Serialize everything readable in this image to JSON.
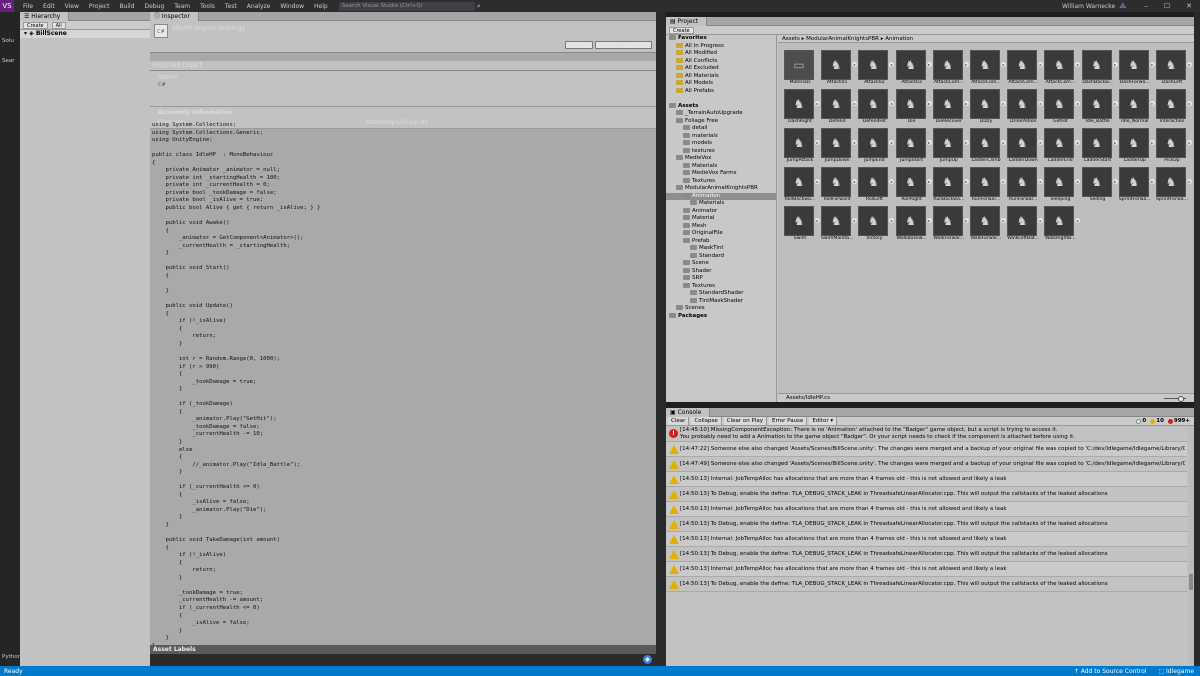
{
  "vs": {
    "logo": "VS",
    "menu": [
      "File",
      "Edit",
      "View",
      "Project",
      "Build",
      "Debug",
      "Team",
      "Tools",
      "Test",
      "Analyze",
      "Window",
      "Help"
    ],
    "search_placeholder": "Search Visual Studio (Ctrl+Q)",
    "user": "William Warnecke",
    "left_labels": [
      "Solu",
      "Sear",
      "Python"
    ]
  },
  "status": {
    "left": "Ready",
    "source_control": "Add to Source Control",
    "project": "Idlegame"
  },
  "hierarchy": {
    "tab": "Hierarchy",
    "create": "Create",
    "filter": "All",
    "scene": "BillScene"
  },
  "inspector": {
    "tab": "Inspector",
    "title": "IdleHP Import Settings",
    "btn_open": "Open...",
    "btn_exec": "Execution Order...",
    "imported_object": "Imported Object",
    "script_name": "IdleHP",
    "cs": "C#",
    "assembly_header": "Assembly Information",
    "filename_key": "Filename",
    "filename_value": "Assembly-CSharp.dll",
    "code": "using System.Collections;\nusing System.Collections.Generic;\nusing UnityEngine;\n\npublic class IdleHP  : MonoBehaviour\n{\n    private Animator _animator = null;\n    private int _startingHealth = 100;\n    private int _currentHealth = 0;\n    private bool _tookDamage = false;\n    private bool _isAlive = true;\n    public bool Alive { get { return _isAlive; } }\n\n    public void Awake()\n    {\n        _animator = GetComponent<Animator>();\n        _currentHealth = _startingHealth;\n    }\n\n    public void Start()\n    {\n\n    }\n\n    public void Update()\n    {\n        if (!_isAlive)\n        {\n            return;\n        }\n\n        int r = Random.Range(0, 1000);\n        if (r > 990)\n        {\n            _tookDamage = true;\n        }\n\n        if (_tookDamage)\n        {\n            _animator.Play(\"GetHit\");\n            _tookDamage = false;\n            _currentHealth -= 10;\n        }\n        else\n        {\n            //_animator.Play(\"Idle_Battle\");\n        }\n\n        if (_currentHealth <= 0)\n        {\n            _isAlive = false;\n            _animator.Play(\"Die\");\n        }\n    }\n\n    public void TakeDamage(int amount)\n    {\n        if (!_isAlive)\n        {\n            return;\n        }\n\n        _tookDamage = true;\n        _currentHealth -= amount;\n        if (_currentHealth <= 0)\n        {\n            _isAlive = false;\n        }\n    }\n}",
    "asset_labels": "Asset Labels"
  },
  "project": {
    "tab": "Project",
    "create": "Create",
    "breadcrumb": "Assets ▸ ModularAnimalKnightsPBR ▸ Animation",
    "footer_path": "Assets/IdleHP.cs",
    "tree": [
      {
        "label": "Favorites",
        "depth": 0,
        "bold": true
      },
      {
        "label": "All In Progress",
        "depth": 1,
        "fav": true
      },
      {
        "label": "All Modified",
        "depth": 1,
        "fav": true
      },
      {
        "label": "All Conflicts",
        "depth": 1,
        "fav": true
      },
      {
        "label": "All Excluded",
        "depth": 1,
        "fav": true
      },
      {
        "label": "All Materials",
        "depth": 1,
        "fav": true
      },
      {
        "label": "All Models",
        "depth": 1,
        "fav": true
      },
      {
        "label": "All Prefabs",
        "depth": 1,
        "fav": true
      },
      {
        "label": "",
        "depth": 0
      },
      {
        "label": "Assets",
        "depth": 0,
        "bold": true
      },
      {
        "label": "_TerrainAutoUpgrade",
        "depth": 1
      },
      {
        "label": "Foliage Free",
        "depth": 1
      },
      {
        "label": "detail",
        "depth": 2
      },
      {
        "label": "materials",
        "depth": 2
      },
      {
        "label": "models",
        "depth": 2
      },
      {
        "label": "textures",
        "depth": 2
      },
      {
        "label": "MedieVox",
        "depth": 1
      },
      {
        "label": "Materials",
        "depth": 2
      },
      {
        "label": "MedieVox Farms",
        "depth": 2
      },
      {
        "label": "Textures",
        "depth": 2
      },
      {
        "label": "ModularAnimalKnightsPBR",
        "depth": 1
      },
      {
        "label": "Animation",
        "depth": 2,
        "sel": true
      },
      {
        "label": "Materials",
        "depth": 3
      },
      {
        "label": "Animator",
        "depth": 2
      },
      {
        "label": "Material",
        "depth": 2
      },
      {
        "label": "Mesh",
        "depth": 2
      },
      {
        "label": "OriginalFile",
        "depth": 2
      },
      {
        "label": "Prefab",
        "depth": 2
      },
      {
        "label": "MaskTint",
        "depth": 3
      },
      {
        "label": "Standard",
        "depth": 3
      },
      {
        "label": "Scene",
        "depth": 2
      },
      {
        "label": "Shader",
        "depth": 2
      },
      {
        "label": "SRP",
        "depth": 2
      },
      {
        "label": "Textures",
        "depth": 2
      },
      {
        "label": "StandardShader",
        "depth": 3
      },
      {
        "label": "TintMaskShader",
        "depth": 3
      },
      {
        "label": "Scenes",
        "depth": 1
      },
      {
        "label": "Packages",
        "depth": 0,
        "bold": true
      }
    ],
    "assets": [
      "Materials",
      "Attack01",
      "Attack02",
      "Attack03",
      "AttackCom...",
      "AttackCom...",
      "AttackCom...",
      "AttackCom...",
      "DashBackw...",
      "DashForwa...",
      "DashLeft",
      "DashRight",
      "Defend",
      "DefendHit",
      "Die",
      "DieRecover",
      "Dizzy",
      "DrinkPotion",
      "GetHit",
      "Idle_Battle",
      "Idle_Normal",
      "Interaction",
      "JumpAttack",
      "JumpDown",
      "JumpEnd",
      "JumpStart",
      "JumpUp",
      "LadderClimb",
      "LadderDown",
      "LadderEnd",
      "LadderStart",
      "LadderUp",
      "PickUp",
      "RollBackwa...",
      "RollForward",
      "RollLeft",
      "RollRight",
      "RunBackwa...",
      "RunForwar...",
      "RunForwar...",
      "Sleeping",
      "Sliding",
      "SprintForwa...",
      "SprintForwa...",
      "Swim",
      "SwimMainta...",
      "Victory",
      "WalkBackw...",
      "WalkForwar...",
      "WalkForwar...",
      "WalkLeftBat...",
      "WalkRightB..."
    ]
  },
  "console": {
    "tab": "Console",
    "buttons": [
      "Clear",
      "Collapse",
      "Clear on Play",
      "Error Pause",
      "Editor"
    ],
    "count_info": "0",
    "count_warn": "10",
    "count_err": "999+",
    "entries": [
      {
        "type": "error",
        "text": "[14:45:10] MissingComponentException: There is no 'Animation' attached to the \"Badger\" game object, but a script is trying to access it.\nYou probably need to add a Animation to the game object \"Badger\". Or your script needs to check if the component is attached before using it."
      },
      {
        "type": "warn",
        "text": "[14:47:22] Someone else also changed 'Assets/Scenes/BillScene.unity'. The changes were merged and a backup of your original file was copied to 'C:/dev/Idlegame/Idlegame/Library/Co"
      },
      {
        "type": "warn",
        "text": "[14:47:49] Someone else also changed 'Assets/Scenes/BillScene.unity'. The changes were merged and a backup of your original file was copied to 'C:/dev/Idlegame/Idlegame/Library/Co"
      },
      {
        "type": "warn",
        "text": "[14:50:13] Internal: JobTempAlloc has allocations that are more than 4 frames old - this is not allowed and likely a leak"
      },
      {
        "type": "warn",
        "text": "[14:50:13] To Debug, enable the define: TLA_DEBUG_STACK_LEAK in ThreadsafeLinearAllocator.cpp. This will output the callstacks of the leaked allocations"
      },
      {
        "type": "warn",
        "text": "[14:50:13] Internal: JobTempAlloc has allocations that are more than 4 frames old - this is not allowed and likely a leak"
      },
      {
        "type": "warn",
        "text": "[14:50:13] To Debug, enable the define: TLA_DEBUG_STACK_LEAK in ThreadsafeLinearAllocator.cpp. This will output the callstacks of the leaked allocations"
      },
      {
        "type": "warn",
        "text": "[14:50:13] Internal: JobTempAlloc has allocations that are more than 4 frames old - this is not allowed and likely a leak"
      },
      {
        "type": "warn",
        "text": "[14:50:13] To Debug, enable the define: TLA_DEBUG_STACK_LEAK in ThreadsafeLinearAllocator.cpp. This will output the callstacks of the leaked allocations"
      },
      {
        "type": "warn",
        "text": "[14:50:13] Internal: JobTempAlloc has allocations that are more than 4 frames old - this is not allowed and likely a leak"
      },
      {
        "type": "warn",
        "text": "[14:50:13] To Debug, enable the define: TLA_DEBUG_STACK_LEAK in ThreadsafeLinearAllocator.cpp. This will output the callstacks of the leaked allocations"
      }
    ]
  },
  "colors": {
    "vs_accent": "#007acc",
    "unity_panel": "#c2c2c2",
    "warn": "#e2b100",
    "error": "#d21f1f"
  }
}
